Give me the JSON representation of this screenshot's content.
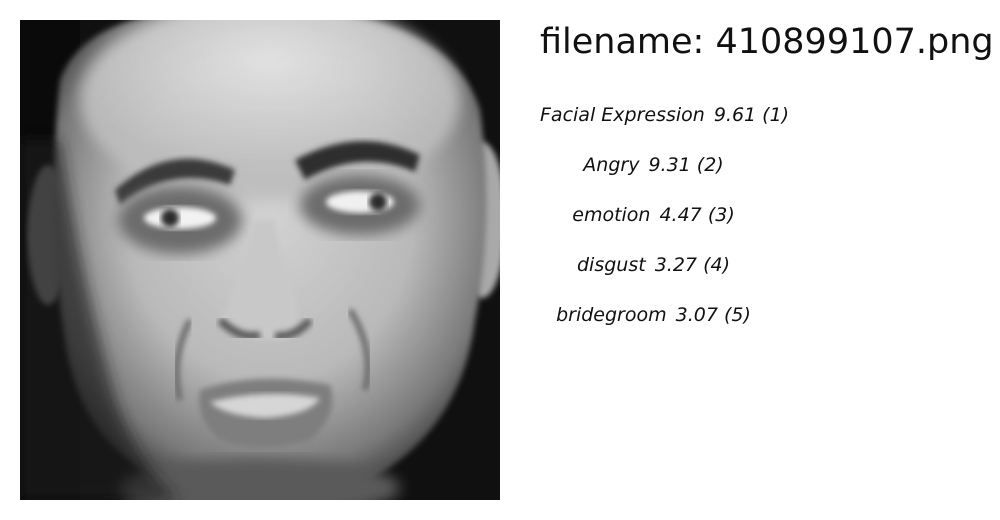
{
  "header": {
    "filename": "filename: 410899107.png"
  },
  "image": {
    "subject": "grayscale close-up face photo",
    "expression": "grimace"
  },
  "labels": [
    {
      "name": "Facial Expression",
      "score": "9.61",
      "rank": "(1)"
    },
    {
      "name": "Angry",
      "score": "9.31",
      "rank": "(2)"
    },
    {
      "name": "emotion",
      "score": "4.47",
      "rank": "(3)"
    },
    {
      "name": "disgust",
      "score": "3.27",
      "rank": "(4)"
    },
    {
      "name": "bridegroom",
      "score": "3.07",
      "rank": "(5)"
    }
  ]
}
